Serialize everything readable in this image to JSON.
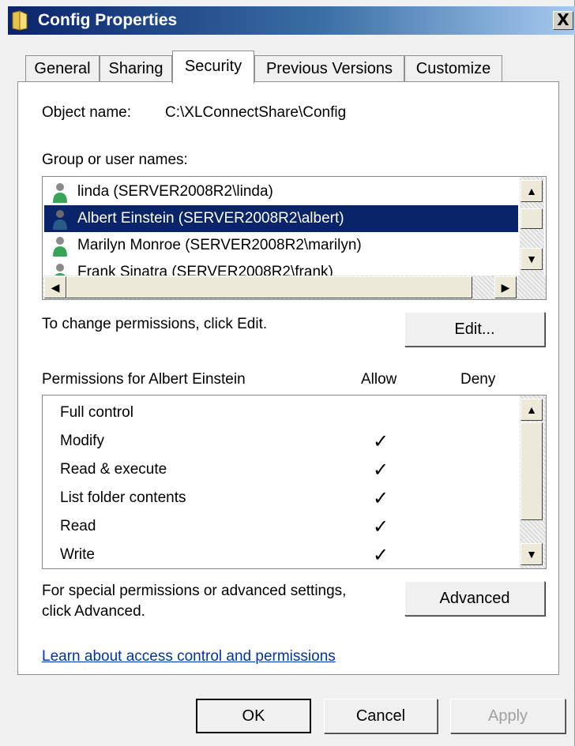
{
  "window": {
    "title": "Config Properties",
    "close_label": "X"
  },
  "tabs": [
    {
      "label": "General",
      "active": false
    },
    {
      "label": "Sharing",
      "active": false
    },
    {
      "label": "Security",
      "active": true
    },
    {
      "label": "Previous Versions",
      "active": false
    },
    {
      "label": "Customize",
      "active": false
    }
  ],
  "security": {
    "object_name_label": "Object name:",
    "object_name_value": "C:\\XLConnectShare\\Config",
    "group_label": "Group or user names:",
    "users": [
      {
        "name": "linda (SERVER2008R2\\linda)",
        "selected": false
      },
      {
        "name": "Albert Einstein (SERVER2008R2\\albert)",
        "selected": true
      },
      {
        "name": "Marilyn Monroe (SERVER2008R2\\marilyn)",
        "selected": false
      },
      {
        "name": "Frank Sinatra (SERVER2008R2\\frank)",
        "selected": false
      }
    ],
    "change_text": "To change permissions, click Edit.",
    "edit_label": "Edit...",
    "permissions_label": "Permissions for Albert Einstein",
    "allow_label": "Allow",
    "deny_label": "Deny",
    "permissions": [
      {
        "name": "Full control",
        "allow": false,
        "deny": false
      },
      {
        "name": "Modify",
        "allow": true,
        "deny": false
      },
      {
        "name": "Read & execute",
        "allow": true,
        "deny": false
      },
      {
        "name": "List folder contents",
        "allow": true,
        "deny": false
      },
      {
        "name": "Read",
        "allow": true,
        "deny": false
      },
      {
        "name": "Write",
        "allow": true,
        "deny": false
      }
    ],
    "check_glyph": "✓",
    "special_text_line1": "For special permissions or advanced settings,",
    "special_text_line2": "click Advanced.",
    "advanced_label": "Advanced",
    "learn_link": "Learn about access control and permissions"
  },
  "buttons": {
    "ok": "OK",
    "cancel": "Cancel",
    "apply": "Apply"
  },
  "colors": {
    "selection": "#0a246a",
    "title_bar": "#0a246a",
    "link": "#0033aa"
  }
}
